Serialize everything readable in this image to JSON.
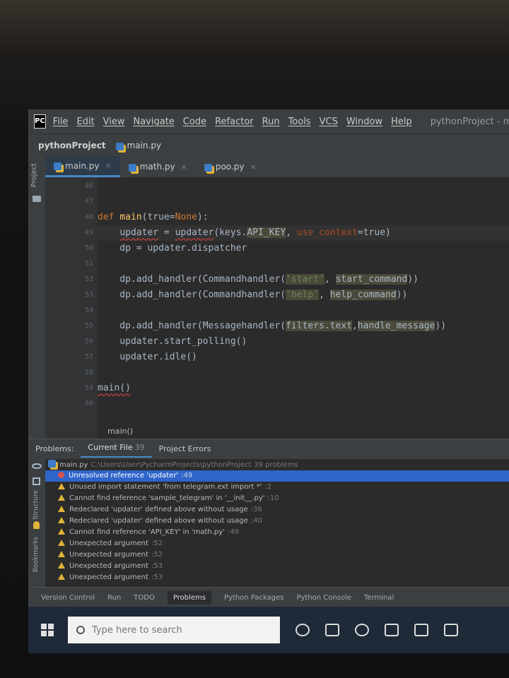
{
  "app": {
    "icon": "PC",
    "menu": [
      "File",
      "Edit",
      "View",
      "Navigate",
      "Code",
      "Refactor",
      "Run",
      "Tools",
      "VCS",
      "Window",
      "Help"
    ],
    "window_title": "pythonProject - mai"
  },
  "breadcrumb": {
    "project": "pythonProject",
    "file": "main.py"
  },
  "left_strip_label": "Project",
  "tabs": [
    {
      "label": "main.py",
      "close": "×",
      "active": true
    },
    {
      "label": "math.py",
      "close": "×",
      "active": false
    },
    {
      "label": "poo.py",
      "close": "×",
      "active": false
    }
  ],
  "editor": {
    "line_numbers": [
      "46",
      "47",
      "48",
      "49",
      "50",
      "51",
      "52",
      "53",
      "54",
      "55",
      "56",
      "57",
      "58",
      "59",
      "60"
    ],
    "code": {
      "l48_kw": "def ",
      "l48_fn": "main",
      "l48_a": "(true=",
      "l48_none": "None",
      "l48_b": "):",
      "l49_a": "    ",
      "l49_u1": "updater",
      "l49_b": " = ",
      "l49_u2": "updater",
      "l49_c": "(keys.",
      "l49_key": "API_KEY",
      "l49_d": ", ",
      "l49_kw": "use_context",
      "l49_e": "=true)",
      "l50": "    dp = updater.dispatcher",
      "l52_a": "    dp.add_handler(Commandhandler(",
      "l52_str": "'start'",
      "l52_b": ", ",
      "l52_arg": "start_command",
      "l52_c": "))",
      "l53_a": "    dp.add_handler(Commandhandler(",
      "l53_str": "'help'",
      "l53_b": ", ",
      "l53_arg": "help_command",
      "l53_c": "))",
      "l55_a": "    dp.add_handler(Messagehandler(",
      "l55_arg1": "filters.text",
      "l55_b": ",",
      "l55_arg2": "handle_message",
      "l55_c": "))",
      "l56": "    updater.start_polling()",
      "l57": "    updater.idle()",
      "l59": "main()"
    },
    "breadcrumb_bottom": "main()"
  },
  "problems": {
    "tabs": [
      {
        "label": "Problems:",
        "count": ""
      },
      {
        "label": "Current File",
        "count": "39"
      },
      {
        "label": "Project Errors",
        "count": ""
      }
    ],
    "file_row": {
      "file": "main.py",
      "path": "C:\\Users\\User\\PycharmProjects\\pythonProject",
      "count": "39 problems"
    },
    "items": [
      {
        "type": "error",
        "text": "Unresolved reference 'updater'",
        "line": ":49"
      },
      {
        "type": "warning",
        "text": "Unused import statement 'from telegram.ext import *'",
        "line": ":2"
      },
      {
        "type": "warning",
        "text": "Cannot find reference 'sample_telegram' in '__init__.py'",
        "line": ":10"
      },
      {
        "type": "warning",
        "text": "Redeclared 'updater' defined above without usage",
        "line": ":36"
      },
      {
        "type": "warning",
        "text": "Redeclared 'updater' defined above without usage",
        "line": ":40"
      },
      {
        "type": "warning",
        "text": "Cannot find reference 'API_KEY' in 'math.py'",
        "line": ":49"
      },
      {
        "type": "warning",
        "text": "Unexpected argument",
        "line": ":52"
      },
      {
        "type": "warning",
        "text": "Unexpected argument",
        "line": ":52"
      },
      {
        "type": "warning",
        "text": "Unexpected argument",
        "line": ":53"
      },
      {
        "type": "warning",
        "text": "Unexpected argument",
        "line": ":53"
      }
    ],
    "side_labels": [
      "Structure",
      "Bookmarks"
    ]
  },
  "statusbar": [
    "Version Control",
    "Run",
    "TODO",
    "Problems",
    "Python Packages",
    "Python Console",
    "Terminal"
  ],
  "taskbar": {
    "search_placeholder": "Type here to search"
  }
}
